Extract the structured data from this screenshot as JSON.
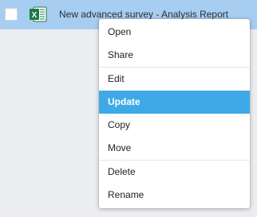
{
  "file_row": {
    "file_name": "New advanced survey - Analysis Report",
    "icon": "excel-file-icon",
    "icon_letter": "X"
  },
  "context_menu": {
    "groups": [
      [
        {
          "label": "Open"
        },
        {
          "label": "Share"
        }
      ],
      [
        {
          "label": "Edit"
        },
        {
          "label": "Update",
          "active": true
        },
        {
          "label": "Copy"
        },
        {
          "label": "Move"
        }
      ],
      [
        {
          "label": "Delete"
        },
        {
          "label": "Rename"
        }
      ]
    ]
  },
  "colors": {
    "row_selected": "#a7cdf0",
    "menu_active": "#3ea9e6",
    "excel_green": "#1f7a45",
    "background": "#ebedf0"
  }
}
